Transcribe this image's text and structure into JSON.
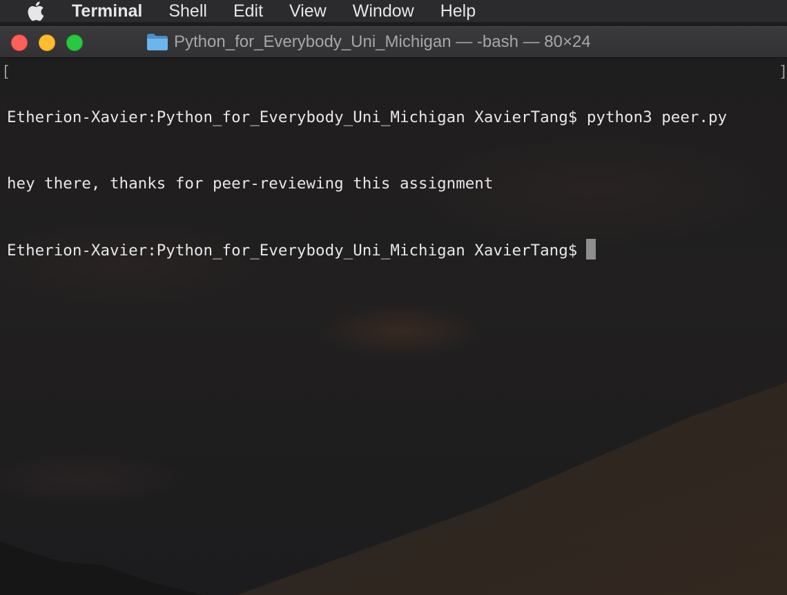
{
  "menubar": {
    "app_name": "Terminal",
    "items": [
      "Shell",
      "Edit",
      "View",
      "Window",
      "Help"
    ]
  },
  "window": {
    "title": "Python_for_Everybody_Uni_Michigan — -bash — 80×24"
  },
  "terminal": {
    "lines": [
      "Etherion-Xavier:Python_for_Everybody_Uni_Michigan XavierTang$ python3 peer.py",
      "hey there, thanks for peer-reviewing this assignment",
      "Etherion-Xavier:Python_for_Everybody_Uni_Michigan XavierTang$"
    ]
  },
  "colors": {
    "close": "#fe5f57",
    "minimize": "#febc2e",
    "zoom": "#28c840",
    "folder": "#5aa9e6"
  }
}
